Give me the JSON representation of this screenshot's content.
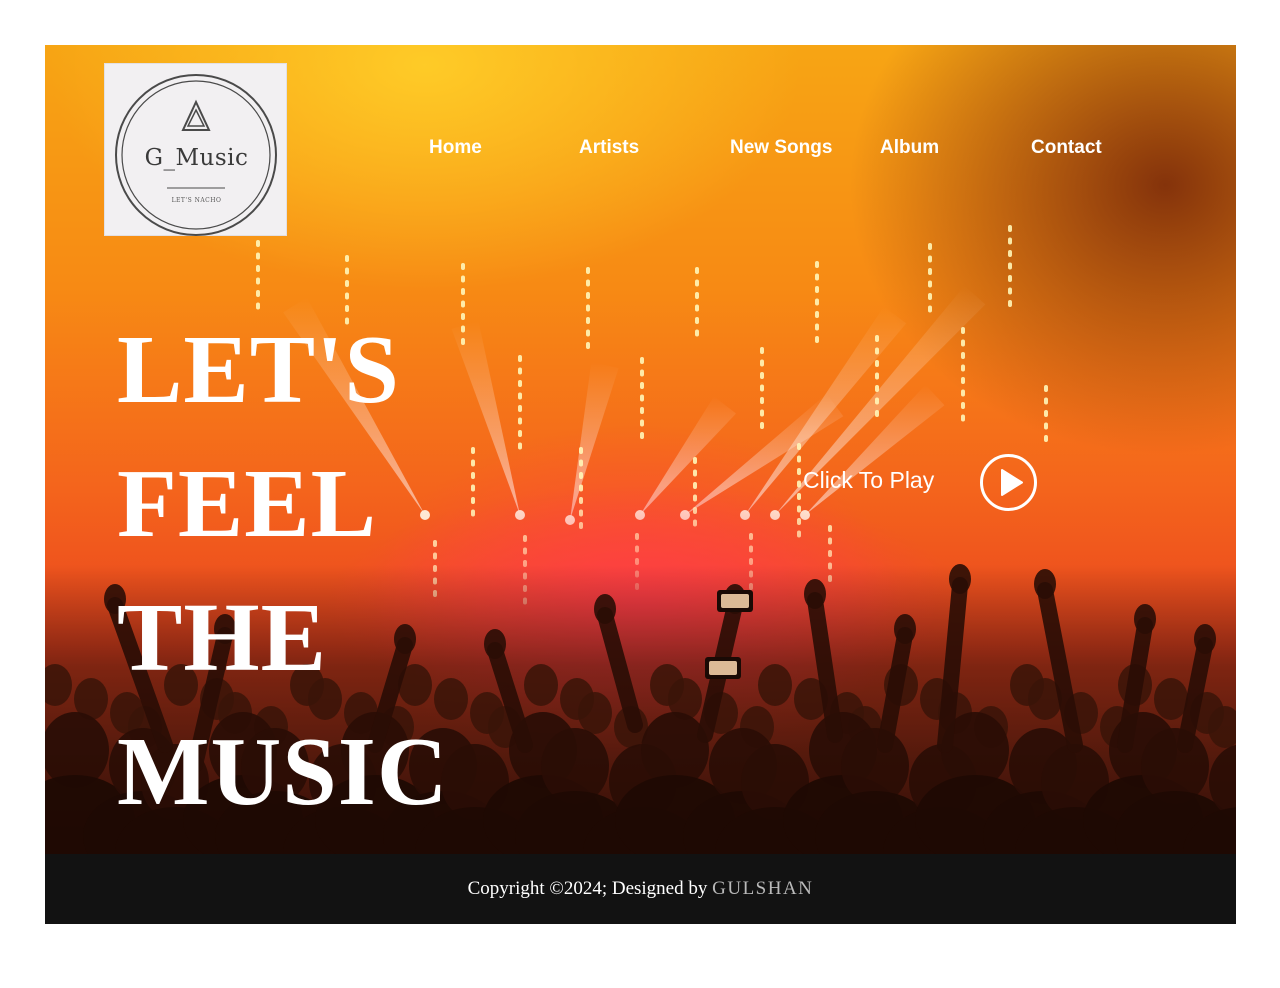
{
  "brand": {
    "logo_title": "G_Music",
    "logo_tagline": "LET'S NACHO"
  },
  "nav": {
    "items": [
      {
        "label": "Home"
      },
      {
        "label": "Artists"
      },
      {
        "label": "New Songs"
      },
      {
        "label": "Album"
      },
      {
        "label": "Contact"
      }
    ]
  },
  "hero": {
    "headline": [
      "LET'S",
      "FEEL",
      "THE",
      "MUSIC"
    ],
    "play_label": "Click To Play",
    "play_icon": "play-circle-icon",
    "background": "concert crowd with stage lights"
  },
  "footer": {
    "copyright": "Copyright ©2024; Designed by ",
    "author": "GULSHAN"
  },
  "colors": {
    "page_background": "#ffffff",
    "hero_orange": "#f78a14",
    "hero_red": "#e9431f",
    "footer_background": "#121212",
    "text_white": "#ffffff",
    "author_gray": "#b9b9b9"
  }
}
